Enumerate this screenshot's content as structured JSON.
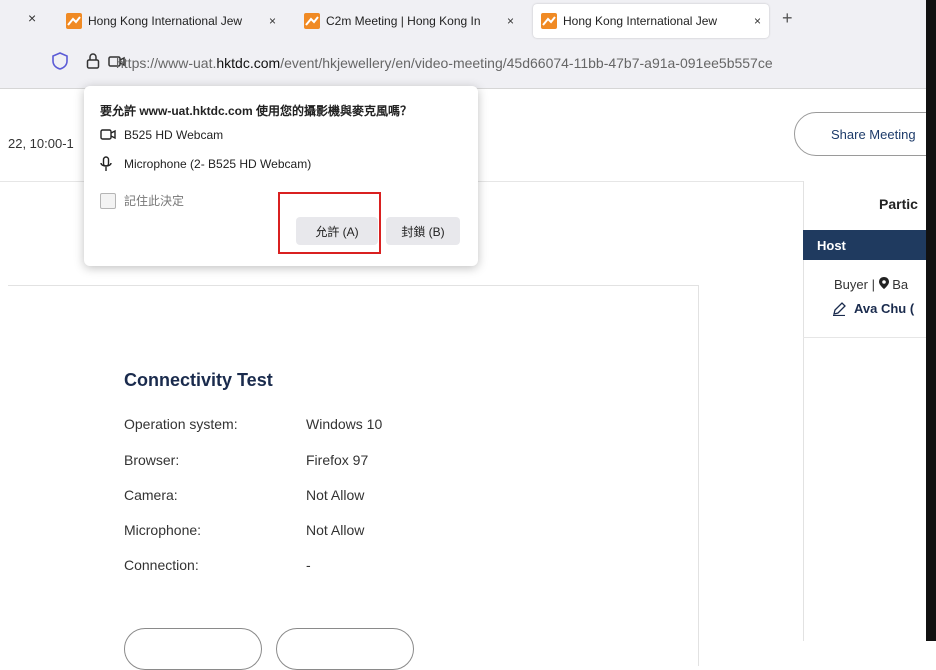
{
  "browser": {
    "leading_close": "×",
    "tabs": [
      {
        "label": "Hong Kong International Jew",
        "close": "×",
        "active": false
      },
      {
        "label": "C2m Meeting | Hong Kong In",
        "close": "×",
        "active": false
      },
      {
        "label": "Hong Kong International Jew",
        "close": "×",
        "active": true
      }
    ],
    "new_tab": "+",
    "url_prefix": "https://www-uat.",
    "url_domain": "hktdc.com",
    "url_path": "/event/hkjewellery/en/video-meeting/45d66074-11bb-47b7-a91a-091ee5b557ce"
  },
  "popup": {
    "title": "要允許 www-uat.hktdc.com 使用您的攝影機與麥克風嗎？",
    "camera": "B525 HD Webcam",
    "microphone": "Microphone (2- B525 HD Webcam)",
    "remember": "記住此決定",
    "allow": "允許 (A)",
    "block": "封鎖 (B)"
  },
  "page": {
    "date_fragment": "22, 10:00-1",
    "share_button": "Share Meeting",
    "connectivity": {
      "title": "Connectivity Test",
      "rows": [
        {
          "label": "Operation system:",
          "value": "Windows 10"
        },
        {
          "label": "Browser:",
          "value": "Firefox 97"
        },
        {
          "label": "Camera:",
          "value": "Not Allow"
        },
        {
          "label": "Microphone:",
          "value": "Not Allow"
        },
        {
          "label": "Connection:",
          "value": "-"
        }
      ]
    }
  },
  "participants": {
    "title": "Partic",
    "host_label": "Host",
    "buyer_line": "Buyer | ",
    "buyer_loc": "Ba",
    "host_name": "Ava Chu ("
  },
  "colors": {
    "brand_orange": "#f08a24",
    "host_bar": "#1f3a5f",
    "highlight": "#d92020"
  }
}
